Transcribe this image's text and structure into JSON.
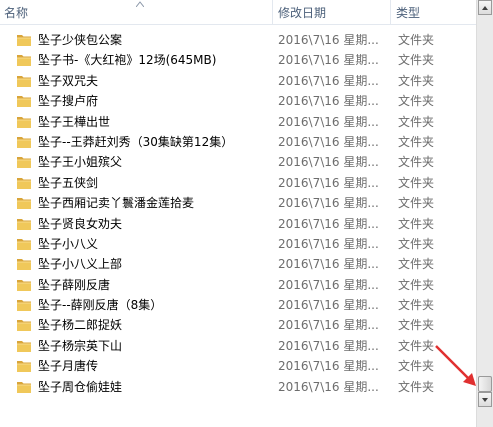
{
  "header": {
    "name_label": "名称",
    "date_label": "修改日期",
    "type_label": "类型"
  },
  "files": [
    {
      "name": "坠子少侠包公案",
      "date": "2016\\7\\16 星期...",
      "type": "文件夹"
    },
    {
      "name": "坠子书-《大红袍》12场(645MB)",
      "date": "2016\\7\\16 星期...",
      "type": "文件夹"
    },
    {
      "name": "坠子双咒夫",
      "date": "2016\\7\\16 星期...",
      "type": "文件夹"
    },
    {
      "name": "坠子搜卢府",
      "date": "2016\\7\\16 星期...",
      "type": "文件夹"
    },
    {
      "name": "坠子王樺出世",
      "date": "2016\\7\\16 星期...",
      "type": "文件夹"
    },
    {
      "name": "坠子--王莽赶刘秀（30集缺第12集）",
      "date": "2016\\7\\16 星期...",
      "type": "文件夹"
    },
    {
      "name": "坠子王小姐殡父",
      "date": "2016\\7\\16 星期...",
      "type": "文件夹"
    },
    {
      "name": "坠子五侠剑",
      "date": "2016\\7\\16 星期...",
      "type": "文件夹"
    },
    {
      "name": "坠子西厢记卖丫鬟潘金莲拾麦",
      "date": "2016\\7\\16 星期...",
      "type": "文件夹"
    },
    {
      "name": "坠子贤良女劝夫",
      "date": "2016\\7\\16 星期...",
      "type": "文件夹"
    },
    {
      "name": "坠子小八义",
      "date": "2016\\7\\16 星期...",
      "type": "文件夹"
    },
    {
      "name": "坠子小八义上部",
      "date": "2016\\7\\16 星期...",
      "type": "文件夹"
    },
    {
      "name": "坠子薛刚反唐",
      "date": "2016\\7\\16 星期...",
      "type": "文件夹"
    },
    {
      "name": "坠子--薛刚反唐（8集）",
      "date": "2016\\7\\16 星期...",
      "type": "文件夹"
    },
    {
      "name": "坠子杨二郎捉妖",
      "date": "2016\\7\\16 星期...",
      "type": "文件夹"
    },
    {
      "name": "坠子杨宗英下山",
      "date": "2016\\7\\16 星期...",
      "type": "文件夹"
    },
    {
      "name": "坠子月唐传",
      "date": "2016\\7\\16 星期...",
      "type": "文件夹"
    },
    {
      "name": "坠子周仓偷娃娃",
      "date": "2016\\7\\16 星期...",
      "type": "文件夹"
    }
  ],
  "colors": {
    "folder": "#e8b84a",
    "header_text": "#4c607a",
    "secondary_text": "#6d6d6d",
    "annotation_arrow": "#e03030"
  }
}
